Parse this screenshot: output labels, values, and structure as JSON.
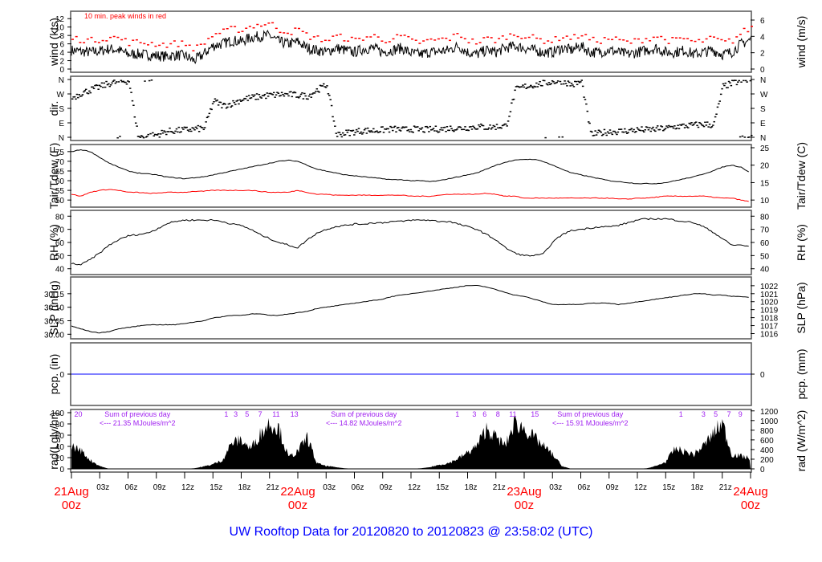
{
  "chart_data": {
    "type": "line",
    "title": "UW Rooftop Data for 20120820  to  20120823 @ 23:58:02  (UTC)",
    "x_hours_range": [
      0,
      72
    ],
    "x_major_labels": [
      {
        "h": 0,
        "l1": "21Aug",
        "l2": "00z"
      },
      {
        "h": 24,
        "l1": "22Aug",
        "l2": "00z"
      },
      {
        "h": 48,
        "l1": "23Aug",
        "l2": "00z"
      },
      {
        "h": 72,
        "l1": "24Aug",
        "l2": "00z"
      }
    ],
    "x_minor_labels": [
      "03z",
      "06z",
      "09z",
      "12z",
      "15z",
      "18z",
      "21z"
    ],
    "panels": [
      {
        "id": "wind",
        "ylabel": "wind (kts)",
        "ylabel_right": "wind (m/s)",
        "ylim": [
          0,
          13
        ],
        "yticks": [
          0,
          2,
          4,
          6,
          8,
          10,
          12
        ],
        "rticks": [
          0,
          2,
          4,
          6
        ],
        "rfactor": 0.5144,
        "note": "10 min. peak winds in red",
        "series": [
          {
            "name": "wind",
            "color": "#000000",
            "hourly": [
              4.5,
              4.2,
              4.0,
              4.3,
              4.8,
              4.5,
              3.5,
              3.6,
              3.4,
              3.2,
              3.0,
              3.3,
              3.2,
              2.0,
              3.5,
              5.5,
              6.0,
              6.8,
              6.5,
              7.5,
              7.8,
              8.0,
              6.5,
              6.0,
              6.5,
              5.0,
              4.5,
              4.0,
              5.0,
              4.5,
              4.0,
              4.8,
              5.0,
              4.0,
              4.5,
              5.0,
              3.8,
              3.5,
              4.0,
              4.2,
              4.5,
              5.5,
              4.0,
              3.5,
              4.5,
              4.0,
              5.0,
              5.5,
              5.0,
              4.5,
              4.0,
              4.0,
              5.0,
              4.5,
              5.5,
              4.0,
              4.0,
              4.5,
              4.0,
              3.5,
              4.0,
              4.5,
              5.0,
              4.0,
              4.0,
              4.5,
              3.5,
              4.0,
              4.5,
              3.5,
              4.0,
              6.0,
              7.0
            ]
          },
          {
            "name": "peak",
            "color": "#ff0000",
            "offset": 2.2
          }
        ]
      },
      {
        "id": "dir",
        "ylabel": "dir.",
        "ylabel_right": "",
        "ylim": [
          0,
          360
        ],
        "ytick_labels": [
          "N",
          "E",
          "S",
          "W",
          "N"
        ],
        "series": [
          {
            "name": "direction",
            "color": "#000000",
            "hourly": [
              250,
              280,
              300,
              320,
              340,
              350,
              355,
              5,
              10,
              20,
              40,
              45,
              50,
              55,
              60,
              230,
              200,
              215,
              240,
              250,
              260,
              265,
              270,
              270,
              265,
              260,
              300,
              330,
              20,
              30,
              40,
              45,
              45,
              50,
              55,
              50,
              55,
              50,
              52,
              55,
              60,
              60,
              65,
              70,
              65,
              70,
              75,
              300,
              320,
              330,
              340,
              350,
              355,
              330,
              350,
              20,
              30,
              40,
              40,
              45,
              50,
              50,
              55,
              60,
              70,
              75,
              80,
              85,
              80,
              320,
              340,
              355,
              358
            ]
          }
        ]
      },
      {
        "id": "temp",
        "ylabel": "Tair/Tdew (F)",
        "ylabel_right": "Tair/Tdew (C)",
        "ylim": [
          48,
          77
        ],
        "yticks": [
          50,
          55,
          60,
          65,
          70,
          75
        ],
        "rticks": [
          10,
          15,
          20,
          25
        ],
        "series": [
          {
            "name": "Tair",
            "color": "#000000",
            "hourly": [
              75,
              76,
              75,
              72,
              69,
              67,
              65,
              64,
              63.5,
              63,
              62,
              61.5,
              61,
              61.5,
              62,
              63,
              64,
              65,
              66,
              67,
              68,
              69,
              70,
              70.5,
              70,
              68,
              66,
              65,
              64,
              63,
              62.5,
              62,
              61.5,
              61,
              60.5,
              60.5,
              60,
              60,
              59.5,
              60,
              61,
              62,
              63,
              64,
              66,
              68,
              69.5,
              70.5,
              71,
              71,
              70,
              68,
              66,
              64,
              63,
              62,
              61,
              60,
              59.5,
              59,
              58.5,
              58.5,
              58.5,
              59,
              60,
              61,
              62,
              63.5,
              65,
              67,
              68,
              67,
              64
            ]
          },
          {
            "name": "Tdew",
            "color": "#ff0000",
            "hourly": [
              53,
              52,
              54,
              55,
              55.5,
              55,
              54,
              54,
              53.5,
              53.5,
              54,
              54,
              54,
              54.5,
              54.5,
              55,
              55,
              55,
              55,
              55,
              54.5,
              54,
              54,
              54,
              55,
              54,
              53,
              53,
              52.5,
              52.5,
              52.5,
              52.5,
              52.5,
              52.5,
              52.5,
              52.5,
              52,
              52,
              52,
              52.5,
              53,
              53,
              53,
              53,
              53.5,
              53,
              52,
              52,
              51,
              51,
              51,
              51,
              51,
              51,
              51,
              51,
              51,
              51,
              50.5,
              50.5,
              51,
              51,
              51.5,
              52,
              52,
              52,
              52,
              52,
              51.5,
              51,
              51,
              50,
              49
            ]
          }
        ]
      },
      {
        "id": "rh",
        "ylabel": "RH (%)",
        "ylabel_right": "RH (%)",
        "ylim": [
          38,
          82
        ],
        "yticks": [
          40,
          50,
          60,
          70,
          80
        ],
        "rticks": [
          40,
          50,
          60,
          70,
          80
        ],
        "series": [
          {
            "name": "RH",
            "color": "#000000",
            "hourly": [
              44,
              43,
              47,
              52,
              58,
              62,
              65,
              66,
              67,
              70,
              74,
              76,
              77,
              77,
              77,
              77,
              76,
              74,
              73,
              70,
              66,
              63,
              60,
              58,
              56,
              62,
              67,
              70,
              72,
              73,
              74,
              74,
              75,
              75,
              76,
              76,
              77,
              77,
              77,
              76,
              76,
              74,
              72,
              70,
              66,
              62,
              56,
              52,
              50,
              50,
              51,
              60,
              66,
              69,
              70,
              71,
              72,
              72,
              73,
              75,
              77,
              78,
              78,
              78,
              77,
              76,
              75,
              72,
              68,
              63,
              58,
              58,
              57
            ]
          }
        ]
      },
      {
        "id": "slp",
        "ylabel": "SLP (inHg)",
        "ylabel_right": "SLP (hPa)",
        "ylim": [
          29.995,
          30.2
        ],
        "yticks": [
          30.0,
          30.05,
          30.1,
          30.15
        ],
        "rticks": [
          1016,
          1017,
          1018,
          1019,
          1020,
          1021,
          1022
        ],
        "series": [
          {
            "name": "SLP",
            "color": "#000000",
            "hourly": [
              30.03,
              30.02,
              30.01,
              30.005,
              30.01,
              30.02,
              30.025,
              30.03,
              30.035,
              30.035,
              30.035,
              30.035,
              30.04,
              30.045,
              30.05,
              30.06,
              30.065,
              30.07,
              30.07,
              30.075,
              30.075,
              30.07,
              30.07,
              30.075,
              30.08,
              30.085,
              30.095,
              30.1,
              30.105,
              30.11,
              30.115,
              30.12,
              30.125,
              30.13,
              30.14,
              30.145,
              30.15,
              30.155,
              30.16,
              30.165,
              30.17,
              30.175,
              30.18,
              30.18,
              30.175,
              30.165,
              30.155,
              30.145,
              30.14,
              30.13,
              30.12,
              30.11,
              30.11,
              30.11,
              30.11,
              30.115,
              30.115,
              30.115,
              30.11,
              30.115,
              30.12,
              30.125,
              30.13,
              30.135,
              30.14,
              30.145,
              30.15,
              30.15,
              30.145,
              30.145,
              30.14,
              30.14,
              30.135
            ]
          }
        ]
      },
      {
        "id": "pcp",
        "ylabel": "pcp. (in)",
        "ylabel_right": "pcp. (mm)",
        "ylim": [
          -1,
          1
        ],
        "yticks": [
          0
        ],
        "rticks": [
          0
        ],
        "series": [
          {
            "name": "precip",
            "color": "#0000ff",
            "hourly": [
              0,
              0
            ]
          }
        ]
      },
      {
        "id": "rad",
        "ylabel": "rad(Lgly/hr)",
        "ylabel_right": "rad (W/m^2)",
        "ylim": [
          0,
          100
        ],
        "yticks": [
          0,
          20,
          40,
          60,
          80,
          100
        ],
        "rticks": [
          0,
          200,
          400,
          600,
          800,
          1000,
          1200
        ],
        "series": [
          {
            "name": "radiation",
            "color": "#000000",
            "hourly": [
              40,
              32,
              15,
              5,
              0,
              0,
              0,
              0,
              0,
              0,
              0,
              0,
              0,
              1,
              4,
              8,
              15,
              45,
              50,
              35,
              60,
              80,
              70,
              20,
              30,
              55,
              10,
              5,
              3,
              1,
              0,
              0,
              0,
              0,
              0,
              0,
              0,
              1,
              3,
              7,
              10,
              18,
              28,
              40,
              70,
              55,
              40,
              80,
              70,
              55,
              40,
              25,
              5,
              0,
              0,
              0,
              0,
              0,
              0,
              0,
              0,
              1,
              5,
              12,
              35,
              30,
              25,
              40,
              60,
              80,
              25,
              22,
              18
            ]
          }
        ],
        "annotations": [
          {
            "h": 0.3,
            "text": "20"
          },
          {
            "h": 7,
            "text": "Sum of previous day"
          },
          {
            "h": 7,
            "text": "<--- 21.35 MJoules/m^2",
            "line": 2
          },
          {
            "h": 31,
            "text": "Sum of previous day"
          },
          {
            "h": 31,
            "text": "<--- 14.82 MJoules/m^2",
            "line": 2
          },
          {
            "h": 55,
            "text": "Sum of previous day"
          },
          {
            "h": 55,
            "text": "<--- 15.91 MJoules/m^2",
            "line": 2
          },
          {
            "h": 16.2,
            "text": "1"
          },
          {
            "h": 17.2,
            "text": "3"
          },
          {
            "h": 18.4,
            "text": "5"
          },
          {
            "h": 19.8,
            "text": "7"
          },
          {
            "h": 21.3,
            "text": "11"
          },
          {
            "h": 23.2,
            "text": "13"
          },
          {
            "h": 40.7,
            "text": "1"
          },
          {
            "h": 42.5,
            "text": "3"
          },
          {
            "h": 43.6,
            "text": "6"
          },
          {
            "h": 45.0,
            "text": "8"
          },
          {
            "h": 46.4,
            "text": "11"
          },
          {
            "h": 48.7,
            "text": "15"
          },
          {
            "h": 64.4,
            "text": "1"
          },
          {
            "h": 66.8,
            "text": "3"
          },
          {
            "h": 68.1,
            "text": "5"
          },
          {
            "h": 69.5,
            "text": "7"
          },
          {
            "h": 70.7,
            "text": "9"
          }
        ]
      }
    ]
  }
}
